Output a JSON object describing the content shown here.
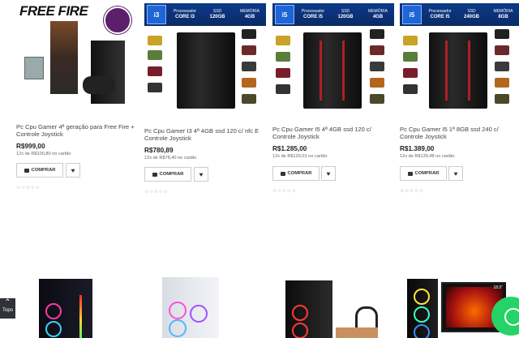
{
  "products": [
    {
      "title": "Pc Cpu Gamer 4ª geração para Free Fire + Controle Joystick",
      "price": "R$999,00",
      "installments": "12x de R$100,80 no cartão",
      "buy_label": "COMPRAR",
      "image_text": "FREE FIRE"
    },
    {
      "title": "Pc Cpu Gamer I3 4ª 4GB ssd 120 c/ nfc E Controle Joystick",
      "price": "R$780,89",
      "installments": "12x de R$78,40 no cartão",
      "buy_label": "COMPRAR",
      "spec": {
        "cpu_badge": "i3",
        "proc_label": "Processador",
        "proc": "CORE I3",
        "ssd_label": "SSD",
        "ssd": "120GB",
        "mem_label": "MEMÓRIA",
        "mem": "4GB"
      }
    },
    {
      "title": "Pc Cpu Gamer I5 4ª 4GB ssd 120 c/ Controle Joystick",
      "price": "R$1.285,00",
      "installments": "12x de R$120,01 no cartão",
      "buy_label": "COMPRAR",
      "spec": {
        "cpu_badge": "i5",
        "proc_label": "Processador",
        "proc": "CORE I5",
        "ssd_label": "SSD",
        "ssd": "120GB",
        "mem_label": "MEMÓRIA",
        "mem": "4GB"
      }
    },
    {
      "title": "Pc Cpu Gamer I5 1ª 8GB ssd 240 c/ Controle Joystick",
      "price": "R$1.389,00",
      "installments": "12x de R$139,48 no cartão",
      "buy_label": "COMPRAR",
      "spec": {
        "cpu_badge": "i5",
        "proc_label": "Processador",
        "proc": "CORE I5",
        "ssd_label": "SSD",
        "ssd": "240GB",
        "mem_label": "MEMÓRIA",
        "mem": "8GB"
      }
    }
  ],
  "top_button_label": "Topo",
  "stars": "☆☆☆☆☆",
  "heart_glyph": "♥",
  "bottom_monitor_label": "18.5\"",
  "colors": {
    "whatsapp": "#25d366",
    "spec_bar": "#0c3a8a",
    "accent_red": "#b11e27"
  },
  "icons": [
    "cart-icon",
    "heart-icon",
    "chevron-up-icon",
    "whatsapp-icon",
    "gamepad-icon"
  ]
}
